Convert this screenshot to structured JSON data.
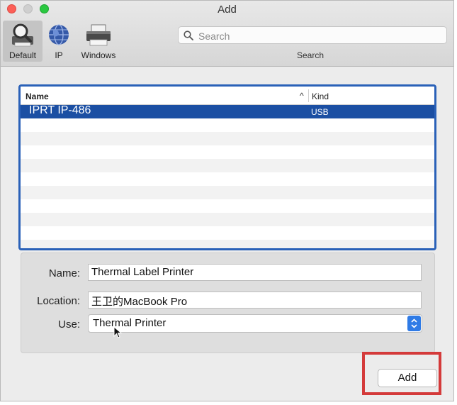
{
  "window": {
    "title": "Add"
  },
  "toolbar": {
    "default_label": "Default",
    "ip_label": "IP",
    "windows_label": "Windows",
    "search_placeholder": "Search",
    "search_label": "Search"
  },
  "printer_list": {
    "columns": {
      "name": "Name",
      "kind": "Kind"
    },
    "sort_indicator": "^",
    "rows": [
      {
        "name": "IPRT IP-486",
        "kind": "USB",
        "selected": true
      }
    ]
  },
  "form": {
    "name_label": "Name:",
    "name_value": "Thermal Label Printer",
    "location_label": "Location:",
    "location_value": "王卫的MacBook Pro",
    "use_label": "Use:",
    "use_value": "Thermal Printer"
  },
  "actions": {
    "add_label": "Add"
  },
  "colors": {
    "selection": "#1b4fa3",
    "list_border": "#2a61b8",
    "highlight_box": "#d43a3a",
    "stepper": "#2f7be6"
  }
}
